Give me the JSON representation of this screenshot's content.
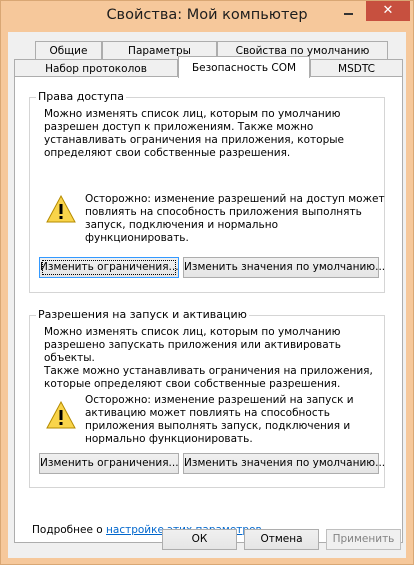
{
  "window": {
    "title": "Свойства: Мой компьютер",
    "close_glyph": "✕",
    "accent": "#f6c89b"
  },
  "tabs": {
    "row1": [
      "Общие",
      "Параметры",
      "Свойства по умолчанию"
    ],
    "row2": [
      "Набор протоколов",
      "Безопасность COM",
      "MSDTC"
    ],
    "active": "Безопасность COM"
  },
  "access": {
    "title": "Права доступа",
    "desc": [
      "Можно изменять список лиц, которым по умолчанию",
      "разрешен доступ к приложениям. Также можно",
      "устанавливать ограничения на приложения, которые",
      "определяют свои собственные разрешения."
    ],
    "warning": [
      "Осторожно: изменение разрешений на доступ может",
      "повлиять на способность приложения выполнять",
      "запуск, подключения и нормально функционировать."
    ],
    "edit_limits": "Изменить ограничения...",
    "edit_defaults": "Изменить значения по умолчанию..."
  },
  "launch": {
    "title": "Разрешения на запуск и активацию",
    "desc": [
      "Можно изменять список лиц, которым по умолчанию",
      "разрешено запускать приложения или активировать объекты.",
      "Также можно устанавливать ограничения на приложения,",
      "которые определяют свои собственные разрешения."
    ],
    "warning": [
      "Осторожно: изменение разрешений на запуск и",
      "активацию может повлиять на способность",
      "приложения выполнять запуск, подключения и",
      "нормально функционировать."
    ],
    "edit_limits": "Изменить ограничения...",
    "edit_defaults": "Изменить значения по умолчанию..."
  },
  "info": {
    "prefix": "Подробнее о ",
    "link": "настройке этих параметров",
    "suffix": "."
  },
  "footer": {
    "ok": "ОК",
    "cancel": "Отмена",
    "apply": "Применить"
  },
  "icons": {
    "warning": "warning-icon"
  }
}
